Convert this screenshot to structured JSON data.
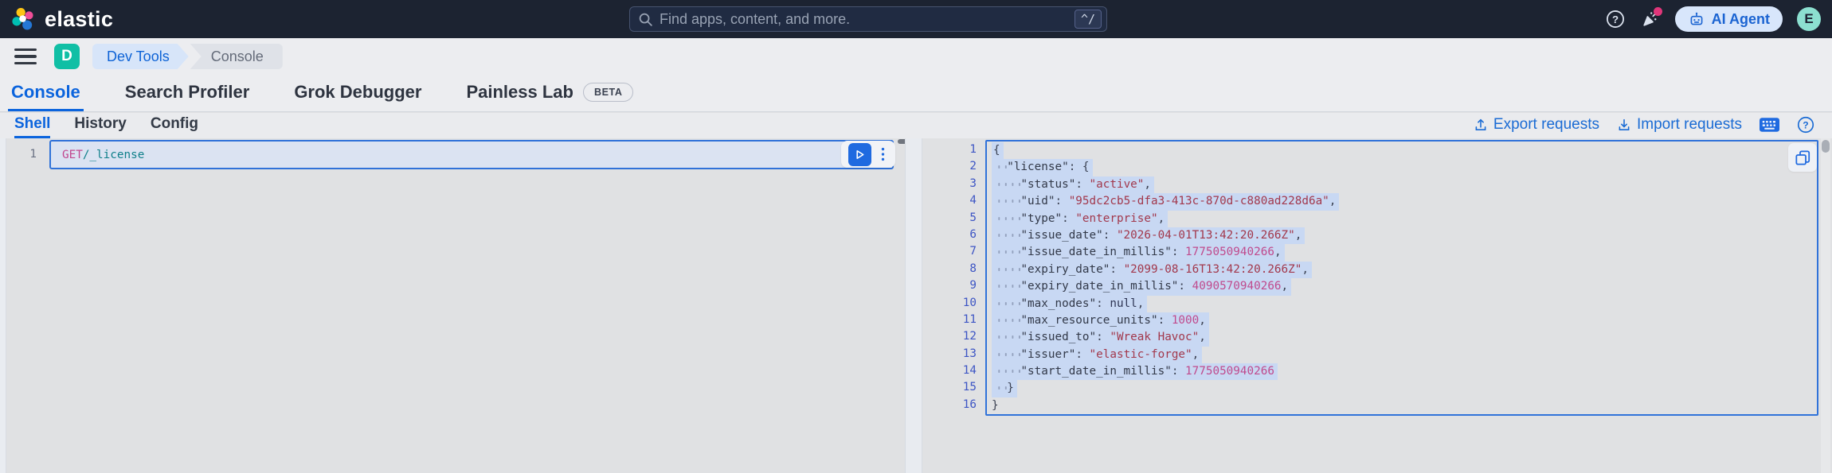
{
  "header": {
    "brand": "elastic",
    "search_placeholder": "Find apps, content, and more.",
    "search_shortcut": "^/",
    "ai_agent_label": "AI Agent",
    "avatar_initial": "E"
  },
  "breadcrumb": {
    "space_initial": "D",
    "items": [
      "Dev Tools",
      "Console"
    ]
  },
  "tabs": [
    {
      "label": "Console",
      "active": true
    },
    {
      "label": "Search Profiler"
    },
    {
      "label": "Grok Debugger"
    },
    {
      "label": "Painless Lab",
      "badge": "BETA"
    }
  ],
  "console_tabs": [
    "Shell",
    "History",
    "Config"
  ],
  "toolbar": {
    "export_label": "Export requests",
    "import_label": "Import requests"
  },
  "editor": {
    "line_number": "1",
    "method": "GET",
    "path": " /_license"
  },
  "response": {
    "lines": [
      {
        "hl": true,
        "t": [
          [
            "p",
            "{"
          ]
        ]
      },
      {
        "hl": true,
        "t": [
          [
            "w",
            "  "
          ],
          [
            "k",
            "\"license\""
          ],
          [
            "p",
            ": {"
          ]
        ]
      },
      {
        "hl": true,
        "t": [
          [
            "w",
            "    "
          ],
          [
            "k",
            "\"status\""
          ],
          [
            "p",
            ": "
          ],
          [
            "s",
            "\"active\""
          ],
          [
            "p",
            ","
          ]
        ]
      },
      {
        "hl": true,
        "t": [
          [
            "w",
            "    "
          ],
          [
            "k",
            "\"uid\""
          ],
          [
            "p",
            ": "
          ],
          [
            "s",
            "\"95dc2cb5-dfa3-413c-870d-c880ad228d6a\""
          ],
          [
            "p",
            ","
          ]
        ]
      },
      {
        "hl": true,
        "t": [
          [
            "w",
            "    "
          ],
          [
            "k",
            "\"type\""
          ],
          [
            "p",
            ": "
          ],
          [
            "s",
            "\"enterprise\""
          ],
          [
            "p",
            ","
          ]
        ]
      },
      {
        "hl": true,
        "t": [
          [
            "w",
            "    "
          ],
          [
            "k",
            "\"issue_date\""
          ],
          [
            "p",
            ": "
          ],
          [
            "s",
            "\"2026-04-01T13:42:20.266Z\""
          ],
          [
            "p",
            ","
          ]
        ]
      },
      {
        "hl": true,
        "t": [
          [
            "w",
            "    "
          ],
          [
            "k",
            "\"issue_date_in_millis\""
          ],
          [
            "p",
            ": "
          ],
          [
            "n",
            "1775050940266"
          ],
          [
            "p",
            ","
          ]
        ]
      },
      {
        "hl": true,
        "t": [
          [
            "w",
            "    "
          ],
          [
            "k",
            "\"expiry_date\""
          ],
          [
            "p",
            ": "
          ],
          [
            "s",
            "\"2099-08-16T13:42:20.266Z\""
          ],
          [
            "p",
            ","
          ]
        ]
      },
      {
        "hl": true,
        "t": [
          [
            "w",
            "    "
          ],
          [
            "k",
            "\"expiry_date_in_millis\""
          ],
          [
            "p",
            ": "
          ],
          [
            "n",
            "4090570940266"
          ],
          [
            "p",
            ","
          ]
        ]
      },
      {
        "hl": true,
        "t": [
          [
            "w",
            "    "
          ],
          [
            "k",
            "\"max_nodes\""
          ],
          [
            "p",
            ": "
          ],
          [
            "u",
            "null"
          ],
          [
            "p",
            ","
          ]
        ]
      },
      {
        "hl": true,
        "t": [
          [
            "w",
            "    "
          ],
          [
            "k",
            "\"max_resource_units\""
          ],
          [
            "p",
            ": "
          ],
          [
            "n",
            "1000"
          ],
          [
            "p",
            ","
          ]
        ]
      },
      {
        "hl": true,
        "t": [
          [
            "w",
            "    "
          ],
          [
            "k",
            "\"issued_to\""
          ],
          [
            "p",
            ": "
          ],
          [
            "s",
            "\"Wreak Havoc\""
          ],
          [
            "p",
            ","
          ]
        ]
      },
      {
        "hl": true,
        "t": [
          [
            "w",
            "    "
          ],
          [
            "k",
            "\"issuer\""
          ],
          [
            "p",
            ": "
          ],
          [
            "s",
            "\"elastic-forge\""
          ],
          [
            "p",
            ","
          ]
        ]
      },
      {
        "hl": true,
        "t": [
          [
            "w",
            "    "
          ],
          [
            "k",
            "\"start_date_in_millis\""
          ],
          [
            "p",
            ": "
          ],
          [
            "n",
            "1775050940266"
          ]
        ]
      },
      {
        "hl": true,
        "t": [
          [
            "w",
            "  "
          ],
          [
            "p",
            "}"
          ]
        ]
      },
      {
        "hl": false,
        "t": [
          [
            "p",
            "}"
          ]
        ]
      }
    ]
  },
  "colors": {
    "accent": "#0b64dd",
    "selection": "#c8d8f3",
    "request_border": "#3072d9",
    "string": "#a2384c",
    "number": "#c04a8d",
    "method": "#c2478f",
    "url": "#0e7f8a",
    "space_chip": "#10bfa5",
    "header_bg": "#1c2331"
  }
}
